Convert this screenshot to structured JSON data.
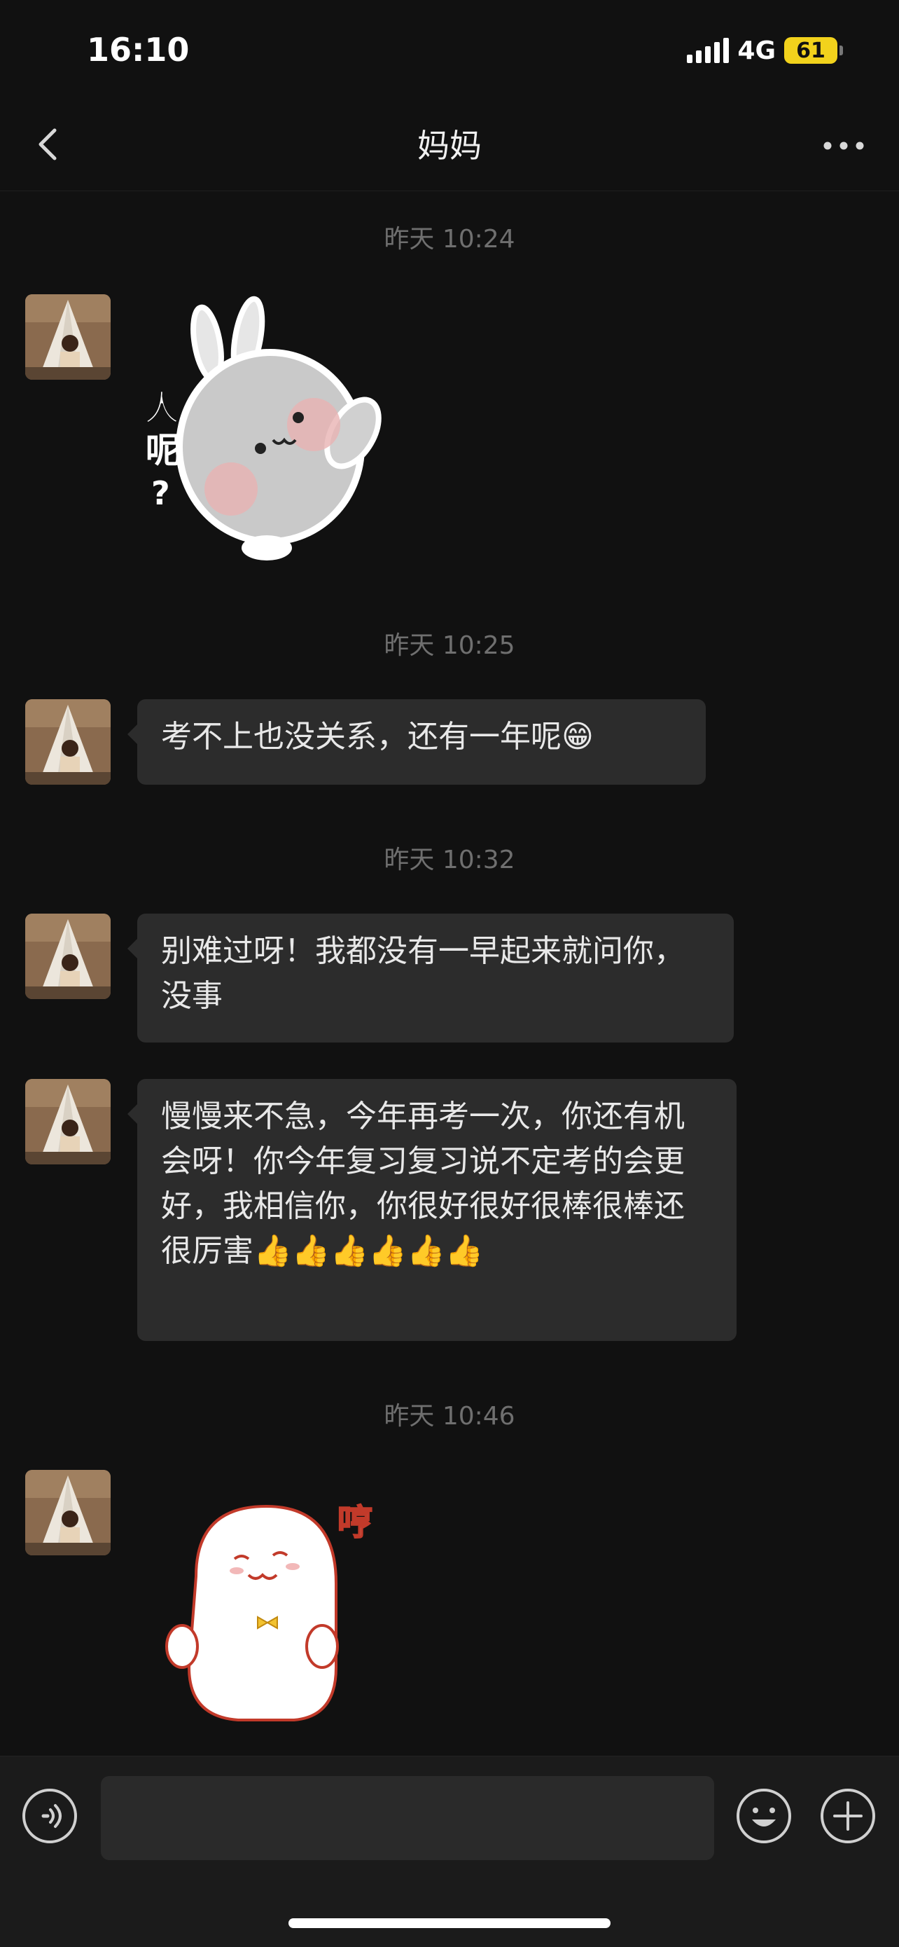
{
  "status_bar": {
    "time": "16:10",
    "network": "4G",
    "battery": "61"
  },
  "nav": {
    "title": "妈妈"
  },
  "messages": [
    {
      "type": "timestamp",
      "text": "昨天 10:24"
    },
    {
      "type": "sticker",
      "sender": "妈妈",
      "caption": "人呢？",
      "description": "grey bunny sticker"
    },
    {
      "type": "timestamp",
      "text": "昨天 10:25"
    },
    {
      "type": "text",
      "sender": "妈妈",
      "text": "考不上也没关系，还有一年呢😁"
    },
    {
      "type": "timestamp",
      "text": "昨天 10:32"
    },
    {
      "type": "text",
      "sender": "妈妈",
      "text": "别难过呀！我都没有一早起来就问你，没事"
    },
    {
      "type": "text",
      "sender": "妈妈",
      "text": "慢慢来不急，今年再考一次，你还有机会呀！你今年复习复习说不定考的会更好，我相信你，你很好很好很棒很棒还很厉害👍👍👍👍👍👍"
    },
    {
      "type": "timestamp",
      "text": "昨天 10:46"
    },
    {
      "type": "sticker",
      "sender": "妈妈",
      "caption": "哼",
      "description": "white seal sticker with bow tie"
    }
  ],
  "input_bar": {
    "placeholder": ""
  },
  "colors": {
    "background": "#111111",
    "bubble": "#2c2c2c",
    "timestamp": "#6f6f6f",
    "battery": "#f2d21c"
  },
  "icons": [
    "back-icon",
    "more-icon",
    "voice-icon",
    "emoji-icon",
    "plus-icon"
  ]
}
